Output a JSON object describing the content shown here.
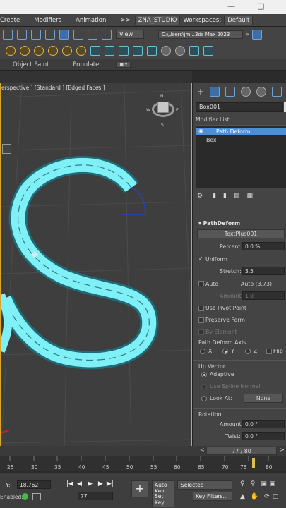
{
  "menu": {
    "create": "Create",
    "modifiers": "Modifiers",
    "animation": "Animation",
    "overflow": ">>"
  },
  "workspace": {
    "app_name": "ZNA_STUDIO",
    "workspaces_label": "Workspaces:",
    "workspaces_value": "Default"
  },
  "toolbar": {
    "view_dropdown": "View",
    "path": "C:\\Users\\jm...3ds Max 2023"
  },
  "ribbon": {
    "object_paint": "Object Paint",
    "populate": "Populate"
  },
  "viewport": {
    "label": "erspective ] [Standard ] [Edged Faces ]",
    "viewcube": {
      "n": "N",
      "s": "S",
      "w": "W",
      "e": "E"
    }
  },
  "command_panel": {
    "object_name": "Box001",
    "modifier_list_label": "Modifier List",
    "stack": [
      "Path Deform",
      "Box"
    ],
    "rollout_title": "PathDeform",
    "path_object": "TextPlus001",
    "percent_label": "Percent:",
    "percent_value": "0.0 %",
    "uniform_label": "Uniform",
    "stretch_label": "Stretch:",
    "stretch_value": "3.5",
    "auto_label": "Auto",
    "auto_value": "Auto (3.73)",
    "amount_label": "Amount:",
    "amount_value": "1.0",
    "use_pivot_label": "Use Pivot Point",
    "preserve_form_label": "Preserve Form",
    "by_element_label": "By Element",
    "axis_title": "Path Deform Axis",
    "axis_x": "X",
    "axis_y": "Y",
    "axis_z": "Z",
    "axis_flip": "Flip",
    "up_vector_title": "Up Vector",
    "adaptive_label": "Adaptive",
    "use_spline_normal_label": "Use Spline Normal",
    "look_at_label": "Look At:",
    "look_at_value": "None",
    "rotation_title": "Rotation",
    "rot_amount_label": "Amount:",
    "rot_amount_value": "0.0 °",
    "twist_label": "Twist:",
    "twist_value": "0.0 °"
  },
  "timeline": {
    "current": "77 / 80",
    "ticks": [
      "25",
      "30",
      "35",
      "40",
      "45",
      "50",
      "55",
      "60",
      "65",
      "70",
      "75",
      "80"
    ],
    "progress_fraction": 0.9625
  },
  "status": {
    "y_label": "Y:",
    "y_value": "18.762",
    "enabled_label": "Enabled:",
    "frame_value": "77",
    "auto_key": "Auto Key",
    "set_key": "Set Key",
    "selected": "Selected",
    "key_filters": "Key Filters..."
  },
  "colors": {
    "accent": "#5ab4e8",
    "selection": "#4a8fd8",
    "frame_highlight": "#d9a62e",
    "shape": "#7ff0f5"
  }
}
